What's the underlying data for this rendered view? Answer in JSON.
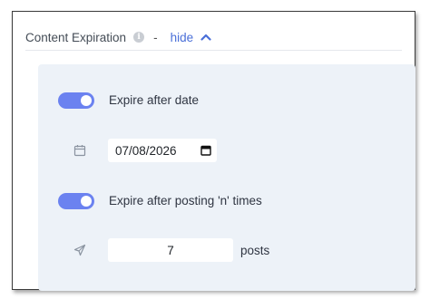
{
  "section": {
    "title": "Content Expiration",
    "info_icon": "info-icon",
    "separator": "-",
    "toggle_label": "hide",
    "toggle_icon": "chevron-up-icon",
    "accent_color": "#4a6fd8"
  },
  "expire_date": {
    "label": "Expire after date",
    "enabled": true,
    "icon": "calendar-icon",
    "value": "07/08/2026"
  },
  "expire_posts": {
    "label": "Expire after posting 'n' times",
    "enabled": true,
    "icon": "send-icon",
    "value": "7",
    "unit": "posts"
  },
  "toggle_color": "#6b82f0",
  "panel_color": "#edf2f8"
}
